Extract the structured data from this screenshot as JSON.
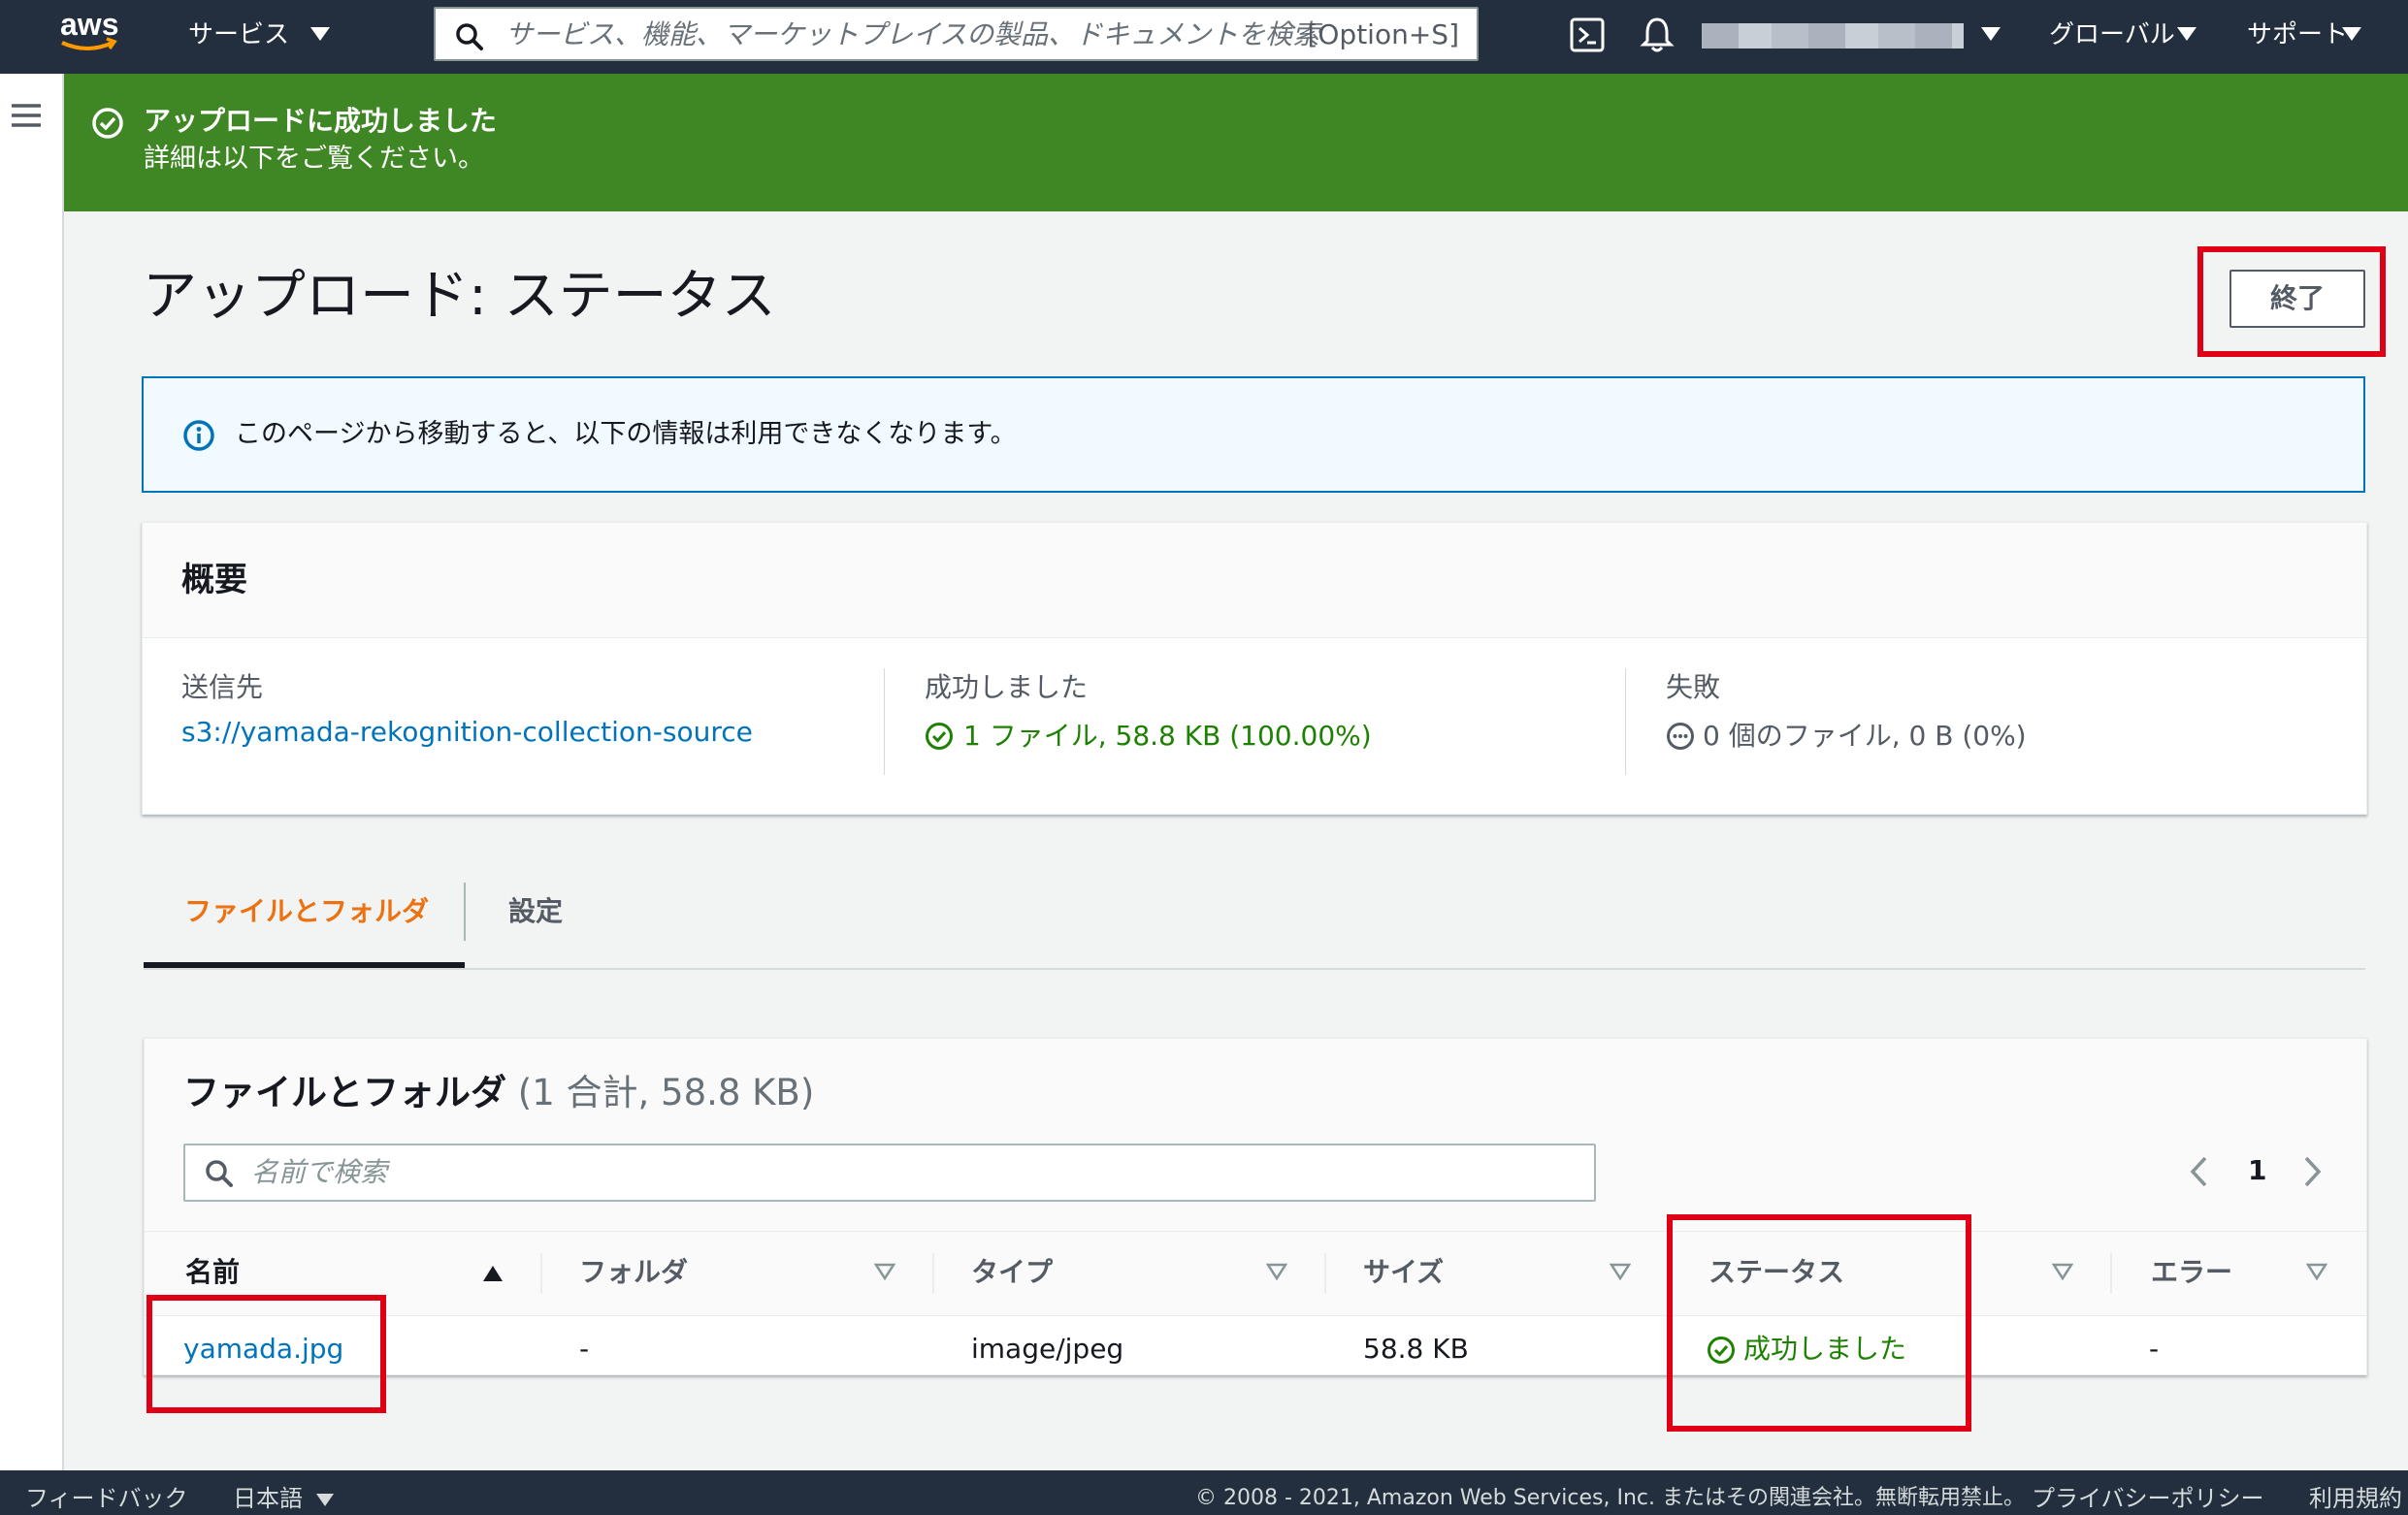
{
  "topnav": {
    "services_label": "サービス",
    "search_placeholder": "サービス、機能、マーケットプレイスの製品、ドキュメントを検索",
    "search_shortcut": "[Option+S]",
    "region_label": "グローバル",
    "support_label": "サポート"
  },
  "flash": {
    "title": "アップロードに成功しました",
    "message": "詳細は以下をご覧ください。"
  },
  "page": {
    "title": "アップロード: ステータス",
    "finish_label": "終了"
  },
  "info": {
    "text": "このページから移動すると、以下の情報は利用できなくなります。"
  },
  "summary": {
    "title": "概要",
    "destination_label": "送信先",
    "destination_value": "s3://yamada-rekognition-collection-source",
    "succeeded_label": "成功しました",
    "succeeded_value": "1 ファイル, 58.8 KB (100.00%)",
    "failed_label": "失敗",
    "failed_value": "0 個のファイル, 0 B (0%)"
  },
  "tabs": [
    {
      "label": "ファイルとフォルダ",
      "active": true
    },
    {
      "label": "設定",
      "active": false
    }
  ],
  "files": {
    "title": "ファイルとフォルダ",
    "count": "(1 合計, 58.8 KB)",
    "search_placeholder": "名前で検索",
    "page_number": "1",
    "columns": [
      "名前",
      "フォルダ",
      "タイプ",
      "サイズ",
      "ステータス",
      "エラー"
    ],
    "rows": [
      {
        "name": "yamada.jpg",
        "folder": "-",
        "type": "image/jpeg",
        "size": "58.8 KB",
        "status": "成功しました",
        "error": "-"
      }
    ]
  },
  "footer": {
    "feedback": "フィードバック",
    "language": "日本語",
    "copyright": "© 2008 - 2021, Amazon Web Services, Inc. またはその関連会社。無断転用禁止。",
    "privacy": "プライバシーポリシー",
    "terms": "利用規約"
  },
  "colors": {
    "nav_bg": "#232f3e",
    "success_green": "#3f8624",
    "success_text": "#1d8102",
    "link_blue": "#0073bb",
    "tab_active": "#ec7211",
    "highlight_red": "#e00015"
  },
  "icons": {
    "logo": "aws-logo",
    "search": "search-icon",
    "cloudshell": "cloudshell-icon",
    "notifications": "bell-icon",
    "menu": "hamburger-icon",
    "success": "check-circle-icon",
    "info": "info-circle-icon",
    "pending": "ellipsis-circle-icon"
  }
}
